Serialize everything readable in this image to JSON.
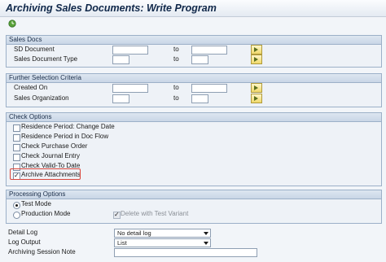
{
  "window": {
    "title": "Archiving Sales Documents: Write Program"
  },
  "toolbar": {
    "execute_icon": "execute-clock-icon"
  },
  "sales_docs": {
    "header": "Sales Docs",
    "rows": [
      {
        "label": "SD Document",
        "from": "",
        "to_label": "to",
        "to": ""
      },
      {
        "label": "Sales Document Type",
        "from": "",
        "to_label": "to",
        "to": ""
      }
    ]
  },
  "further_selection": {
    "header": "Further Selection Criteria",
    "rows": [
      {
        "label": "Created On",
        "from": "",
        "to_label": "to",
        "to": ""
      },
      {
        "label": "Sales Organization",
        "from": "",
        "to_label": "to",
        "to": ""
      }
    ]
  },
  "check_options": {
    "header": "Check Options",
    "items": [
      {
        "label": "Residence Period: Change Date",
        "checked": false
      },
      {
        "label": "Residence Period in Doc Flow",
        "checked": false
      },
      {
        "label": "Check Purchase Order",
        "checked": false
      },
      {
        "label": "Check Journal Entry",
        "checked": false
      },
      {
        "label": "Check Valid-To Date",
        "checked": false
      },
      {
        "label": "Archive Attachments",
        "checked": true
      }
    ]
  },
  "processing_options": {
    "header": "Processing Options",
    "test_mode": "Test Mode",
    "production_mode": "Production Mode",
    "delete_with_test_variant": "Delete with Test Variant",
    "selected": "Test Mode"
  },
  "bottom": {
    "detail_log_label": "Detail Log",
    "detail_log_value": "No detail log",
    "log_output_label": "Log Output",
    "log_output_value": "List",
    "session_note_label": "Archiving Session Note",
    "session_note_value": ""
  },
  "colors": {
    "accent_highlight": "#d9453b",
    "header_text": "#10284a"
  }
}
